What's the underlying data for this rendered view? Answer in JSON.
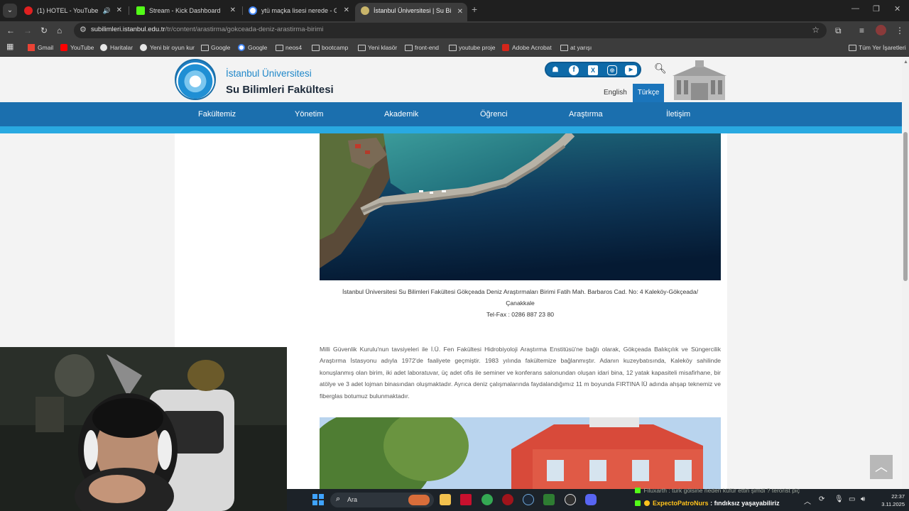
{
  "browser": {
    "tabs": [
      {
        "title": "(1) HOTEL - YouTube",
        "favicon_color": "#e02020",
        "audio": true,
        "active": false
      },
      {
        "title": "Stream - Kick Dashboard",
        "favicon_color": "#53fc18",
        "audio": false,
        "active": false
      },
      {
        "title": "ytü maçka lisesi nerede - Goog",
        "favicon_color": "#ffffff",
        "audio": false,
        "active": false
      },
      {
        "title": "İstanbul Üniversitesi | Su Bilimle",
        "favicon_color": "#c9b56a",
        "audio": false,
        "active": true
      }
    ],
    "new_tab_label": "+",
    "url_domain": "subilimleri.istanbul.edu.tr",
    "url_path": "/tr/content/arastirma/gokceada-deniz-arastirma-birimi",
    "bookmarks": [
      {
        "label": "Gmail",
        "icon": "gmail-icon"
      },
      {
        "label": "YouTube",
        "icon": "youtube-icon"
      },
      {
        "label": "Haritalar",
        "icon": "maps-icon"
      },
      {
        "label": "Yeni bir oyun kur",
        "icon": "site-icon"
      },
      {
        "label": "Google",
        "icon": "folder-icon"
      },
      {
        "label": "Google",
        "icon": "google-icon"
      },
      {
        "label": "neos4",
        "icon": "folder-icon"
      },
      {
        "label": "bootcamp",
        "icon": "folder-icon"
      },
      {
        "label": "Yeni klasör",
        "icon": "folder-icon"
      },
      {
        "label": "front-end",
        "icon": "folder-icon"
      },
      {
        "label": "youtube proje",
        "icon": "folder-icon"
      },
      {
        "label": "Adobe Acrobat",
        "icon": "acrobat-icon"
      },
      {
        "label": "at yarışı",
        "icon": "folder-icon"
      }
    ],
    "all_bookmarks_label": "Tüm Yer İşaretleri"
  },
  "site": {
    "institution": "İstanbul Üniversitesi",
    "faculty": "Su Bilimleri Fakültesi",
    "lang_en": "English",
    "lang_tr": "Türkçe",
    "nav": [
      "Fakültemiz",
      "Yönetim",
      "Akademik",
      "Öğrenci",
      "Araştırma",
      "İletişim"
    ],
    "social_icons": [
      "student-icon",
      "facebook-icon",
      "x-icon",
      "instagram-icon",
      "youtube-icon"
    ]
  },
  "content": {
    "caption_line1": "İstanbul Üniversitesi Su Bilimleri Fakültesi Gökçeada Deniz Araştırmaları Birimi Fatih Mah. Barbaros Cad. No: 4 Kaleköy-Gökçeada/",
    "caption_line2": "Çanakkale",
    "caption_tel": "Tel-Fax : 0286 887 23 80",
    "paragraph": "Milli Güvenlik Kurulu'nun tavsiyeleri ile İ.Ü. Fen Fakültesi Hidrobiyoloji Araştırma Enstitüsü'ne bağlı olarak, Gökçeada Balıkçılık ve Süngercilik Araştırma İstasyonu adıyla 1972'de faaliyete geçmiştir. 1983 yılında fakültemize bağlanmıştır. Adanın kuzeybatısında, Kaleköy sahilinde konuşlanmış olan birim, iki adet laboratuvar, üç adet ofis ile seminer ve konferans salonundan oluşan idari bina, 12 yatak kapasiteli misafirhane, bir atölye ve 3 adet lojman binasından oluşmaktadır. Ayrıca deniz çalışmalarında faydalandığımız 11 m boyunda FIRTINA İÜ adında ahşap teknemiz ve fiberglas botumuz bulunmaktadır."
  },
  "chat": {
    "line1_user": "Filuxarth",
    "line1_text": ": türk gölsine neden küfür ettin şimdi ? terorist piç",
    "line2_user": "ExpectoPatroNurs",
    "line2_text": ": fındıksız yaşayabiliriz"
  },
  "taskbar": {
    "search_placeholder": "Ara",
    "time": "22:37",
    "date": "3.11.2025"
  }
}
